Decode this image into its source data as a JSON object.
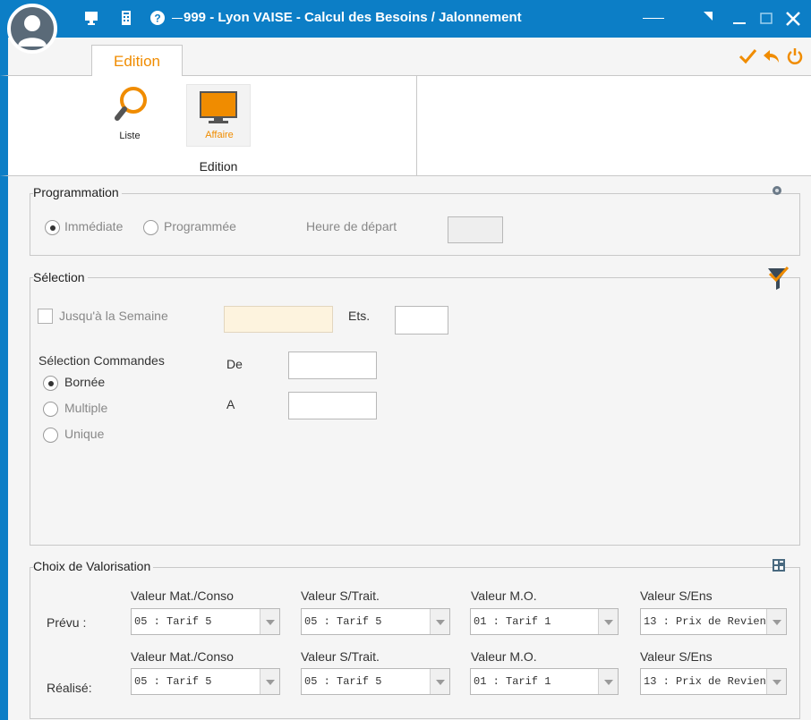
{
  "window": {
    "title": "999 - Lyon VAISE - Calcul des Besoins / Jalonnement",
    "icons": [
      "monitor-icon",
      "phone-icon",
      "help-icon",
      "restore-icon",
      "minimize-icon",
      "maximize-icon",
      "close-icon"
    ]
  },
  "tabs": {
    "active": "Edition"
  },
  "toolbar": {
    "actions": [
      "check-icon",
      "undo-icon",
      "power-icon"
    ]
  },
  "ribbon": {
    "group_label": "Edition",
    "items": [
      {
        "label": "Liste"
      },
      {
        "label": "Affaire"
      }
    ]
  },
  "programmation": {
    "legend": "Programmation",
    "immediate": "Immédiate",
    "programmee": "Programmée",
    "heure_label": "Heure de départ",
    "selected": "immediate"
  },
  "selection": {
    "legend": "Sélection",
    "semaine_label": "Jusqu'à la Semaine",
    "ets_label": "Ets.",
    "commandes_label": "Sélection Commandes",
    "options": [
      "Bornée",
      "Multiple",
      "Unique"
    ],
    "selected": "Bornée",
    "de_label": "De",
    "a_label": "A"
  },
  "valorisation": {
    "legend": "Choix de Valorisation",
    "rows": [
      {
        "label": "Prévu :",
        "cols": [
          {
            "header": "Valeur Mat./Conso",
            "value": "05 : Tarif 5"
          },
          {
            "header": "Valeur S/Trait.",
            "value": "05 : Tarif 5"
          },
          {
            "header": "Valeur M.O.",
            "value": "01 : Tarif 1"
          },
          {
            "header": "Valeur S/Ens",
            "value": "13 : Prix de Revien"
          }
        ]
      },
      {
        "label": "Réalisé:",
        "cols": [
          {
            "header": "Valeur Mat./Conso",
            "value": "05 : Tarif 5"
          },
          {
            "header": "Valeur S/Trait.",
            "value": "05 : Tarif 5"
          },
          {
            "header": "Valeur M.O.",
            "value": "01 : Tarif 1"
          },
          {
            "header": "Valeur S/Ens",
            "value": "13 : Prix de Revien"
          }
        ]
      }
    ]
  },
  "colors": {
    "accent": "#f08c00",
    "titlebar": "#0c7ec6"
  }
}
